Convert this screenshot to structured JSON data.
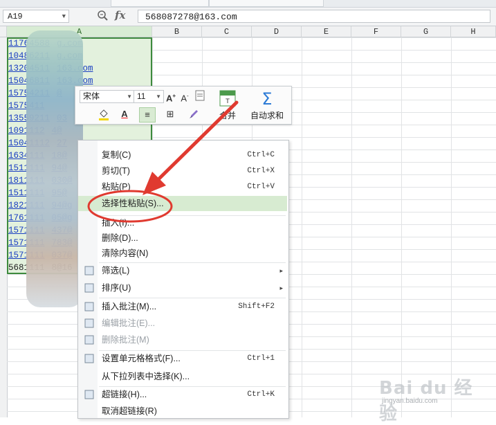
{
  "formula_bar": {
    "name_box": "A19",
    "formula_value": "568087278@163.com"
  },
  "columns": [
    "A",
    "B",
    "C",
    "D",
    "E",
    "F",
    "G",
    "H"
  ],
  "cells": {
    "col_a": [
      "11764588",
      "10486211",
      "13204511",
      "15046811",
      "15754211",
      "1575411",
      "13559211",
      "1091112",
      "15041112",
      "1634111",
      "1511111",
      "1811111",
      "1511111",
      "1821111",
      "1761111",
      "1571111",
      "1571111",
      "1571111",
      "5681111"
    ],
    "visible_fragments": [
      "g.com",
      "g.com",
      "163.com",
      "163.com",
      "@",
      "",
      "03",
      "4@",
      "27",
      "18@",
      "94@",
      "030@",
      "95@",
      "94@g",
      "05@g",
      "437@",
      "783@",
      "037@",
      "8@16"
    ],
    "active_cell_value": "568087278@163.com"
  },
  "mini_toolbar": {
    "font_name": "宋体",
    "font_size": "11",
    "merge_label": "合并",
    "autosum_label": "自动求和"
  },
  "context_menu": {
    "items": [
      {
        "label": "复制(C)",
        "shortcut": "Ctrl+C"
      },
      {
        "label": "剪切(T)",
        "shortcut": "Ctrl+X"
      },
      {
        "label": "粘贴(P)",
        "shortcut": "Ctrl+V"
      },
      {
        "label": "选择性粘贴(S)...",
        "shortcut": ""
      },
      {
        "label": "插入(I)...",
        "shortcut": ""
      },
      {
        "label": "删除(D)...",
        "shortcut": ""
      },
      {
        "label": "清除内容(N)",
        "shortcut": ""
      },
      {
        "label": "筛选(L)",
        "shortcut": ""
      },
      {
        "label": "排序(U)",
        "shortcut": ""
      },
      {
        "label": "插入批注(M)...",
        "shortcut": "Shift+F2"
      },
      {
        "label": "编辑批注(E)...",
        "shortcut": ""
      },
      {
        "label": "删除批注(M)",
        "shortcut": ""
      },
      {
        "label": "设置单元格格式(F)...",
        "shortcut": "Ctrl+1"
      },
      {
        "label": "从下拉列表中选择(K)...",
        "shortcut": ""
      },
      {
        "label": "超链接(H)...",
        "shortcut": "Ctrl+K"
      },
      {
        "label": "取消超链接(R)",
        "shortcut": ""
      }
    ],
    "highlighted_index": 3
  },
  "watermark": {
    "brand": "Bai du 经验",
    "url": "jingyan.baidu.com"
  },
  "colors": {
    "selection_border": "#3d8a3d",
    "selection_fill": "#e3f1dd",
    "menu_highlight": "#d7ebd1",
    "annotation_red": "#e03a30",
    "hyperlink": "#1a3fc2"
  }
}
